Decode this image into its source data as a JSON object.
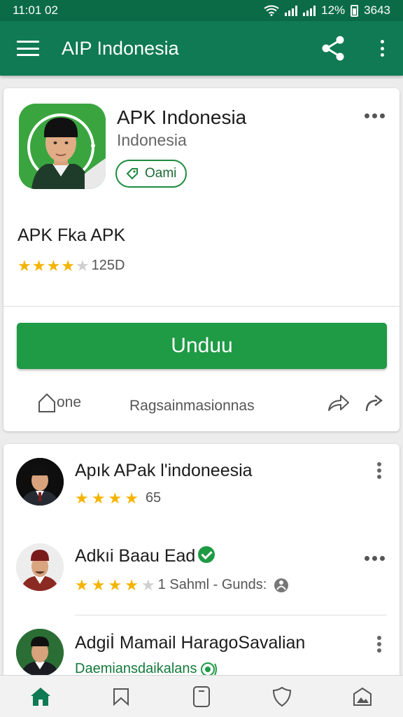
{
  "status_bar": {
    "time": "11:01",
    "extra": "02",
    "battery_percent": "12%",
    "right_text": "3643"
  },
  "app_bar": {
    "title": "AIP Indonesia",
    "menu_icon": "hamburger-menu-icon",
    "share_icon": "share-icon",
    "more_icon": "more-vert-icon"
  },
  "app_card": {
    "name": "APK Indonesia",
    "developer": "Indonesia",
    "chip_label": "Oami",
    "subtitle": "APK Fka APK",
    "stars": 4,
    "rating_count": "125D",
    "download_label": "Unduu",
    "home_label": "one",
    "info_label": "Ragsainmasionnas"
  },
  "list": {
    "items": [
      {
        "name": "Apık APak l'indoneesia",
        "stars": 4,
        "meta": "65",
        "avatar": "man-black-peci"
      },
      {
        "name": "Adkıi Baau Ead",
        "stars": 4,
        "meta": "1 Sahml - Gunds:",
        "avatar": "man-red-peci",
        "verified": true
      },
      {
        "name": "Adgiİ Mamail HaragoSavalian",
        "meta": "Daemiansdaikalans",
        "avatar": "man-black-peci-2"
      }
    ]
  },
  "bottom_nav": [
    "home-icon",
    "bookmark-icon",
    "tablet-icon",
    "shield-icon",
    "gallery-icon"
  ],
  "colors": {
    "primary": "#0f7a53",
    "status": "#0b6b47",
    "accent": "#1f9a45",
    "star": "#f4b400"
  }
}
